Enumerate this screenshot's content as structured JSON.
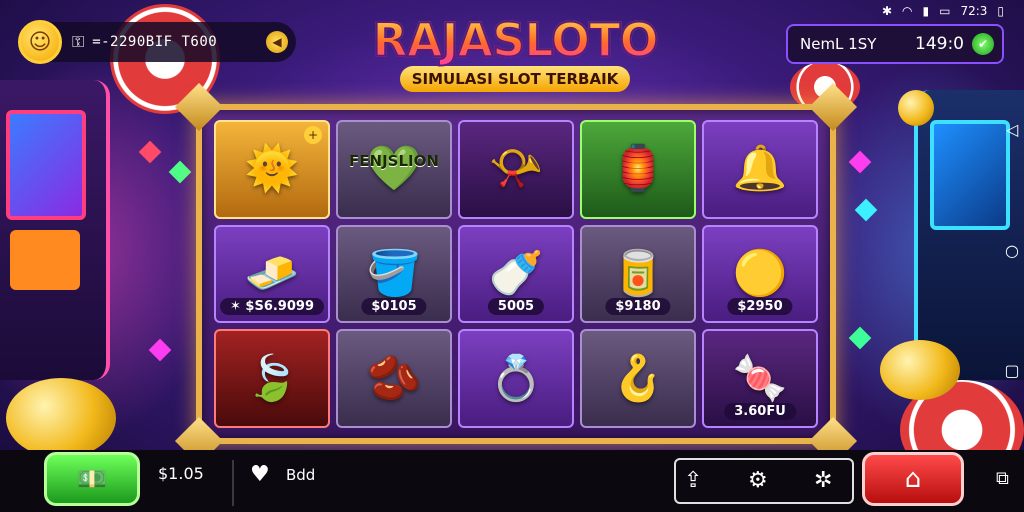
{
  "header": {
    "balance_text": "=-2290BIF T600",
    "status_time": "72:3",
    "right_label": "NemL 1SY",
    "right_value": "149:0"
  },
  "logo": {
    "title": "RAJASLOTO",
    "subtitle": "SIMULASI SLOT TERBAIK"
  },
  "reels": [
    [
      {
        "symbol": "sun",
        "glyph": "🌞",
        "style": "gold",
        "label": "",
        "banner": ""
      },
      {
        "symbol": "gold-bar",
        "glyph": "🧈",
        "style": "",
        "label": "✶ $S6.9099",
        "banner": ""
      },
      {
        "symbol": "leaf-shield",
        "glyph": "🍃",
        "style": "red",
        "label": "",
        "banner": ""
      }
    ],
    [
      {
        "symbol": "heart-shield",
        "glyph": "💚",
        "style": "grey",
        "label": "",
        "banner": "FENJSLION"
      },
      {
        "symbol": "bucket",
        "glyph": "🪣",
        "style": "grey",
        "label": "$0105",
        "banner": ""
      },
      {
        "symbol": "bean",
        "glyph": "🫘",
        "style": "grey",
        "label": "",
        "banner": ""
      }
    ],
    [
      {
        "symbol": "horn",
        "glyph": "📯",
        "style": "dark",
        "label": "",
        "banner": ""
      },
      {
        "symbol": "bottle",
        "glyph": "🍼",
        "style": "",
        "label": "5005",
        "banner": ""
      },
      {
        "symbol": "ring",
        "glyph": "💍",
        "style": "",
        "label": "",
        "banner": ""
      }
    ],
    [
      {
        "symbol": "lantern",
        "glyph": "🏮",
        "style": "green",
        "label": "",
        "banner": ""
      },
      {
        "symbol": "cylinder",
        "glyph": "🥫",
        "style": "grey",
        "label": "$9180",
        "banner": ""
      },
      {
        "symbol": "hook",
        "glyph": "🪝",
        "style": "grey",
        "label": "",
        "banner": ""
      }
    ],
    [
      {
        "symbol": "bell",
        "glyph": "🔔",
        "style": "",
        "label": "",
        "banner": ""
      },
      {
        "symbol": "orb",
        "glyph": "🟡",
        "style": "",
        "label": "$2950",
        "banner": ""
      },
      {
        "symbol": "candy",
        "glyph": "🍬",
        "style": "dark",
        "label": "3.60FU",
        "banner": ""
      }
    ]
  ],
  "bottom": {
    "bet_amount": "$1.05",
    "heart_label": "Bdd"
  },
  "icons": {
    "avatar": "smiley-icon",
    "add_coin": "coin-plus-icon",
    "confirm": "check-icon",
    "bet": "cash-icon",
    "home": "home-icon",
    "heart": "heart-icon",
    "share": "share-icon",
    "settings": "gear-icon",
    "autoplay": "cog-icon"
  },
  "colors": {
    "frame": "#e9b24a",
    "spin": "#e12020",
    "bet": "#36c22a"
  }
}
